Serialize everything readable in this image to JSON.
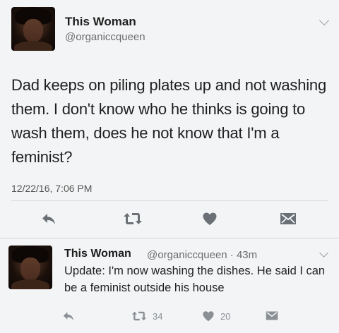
{
  "main_tweet": {
    "name": "This Woman",
    "handle": "@organiccqueen",
    "text": "Dad keeps on piling plates up and not washing them. I don't  know who he thinks is going to wash them, does he not know that I'm a feminist?",
    "timestamp": "12/22/16, 7:06 PM",
    "actions": {
      "reply_icon": "reply-arrow-icon",
      "retweet_icon": "retweet-icon",
      "like_icon": "heart-icon",
      "dm_icon": "envelope-icon"
    }
  },
  "reply_tweet": {
    "name": "This Woman",
    "handle_time": "@organiccqueen · 43m",
    "text": "Update: I'm now washing the dishes. He said I can be a feminist outside his house",
    "actions": {
      "retweet_count": "34",
      "like_count": "20"
    }
  },
  "colors": {
    "background": "#f3f4f5",
    "icon_gray": "#8a8f95",
    "icon_dark": "#6b7077"
  }
}
